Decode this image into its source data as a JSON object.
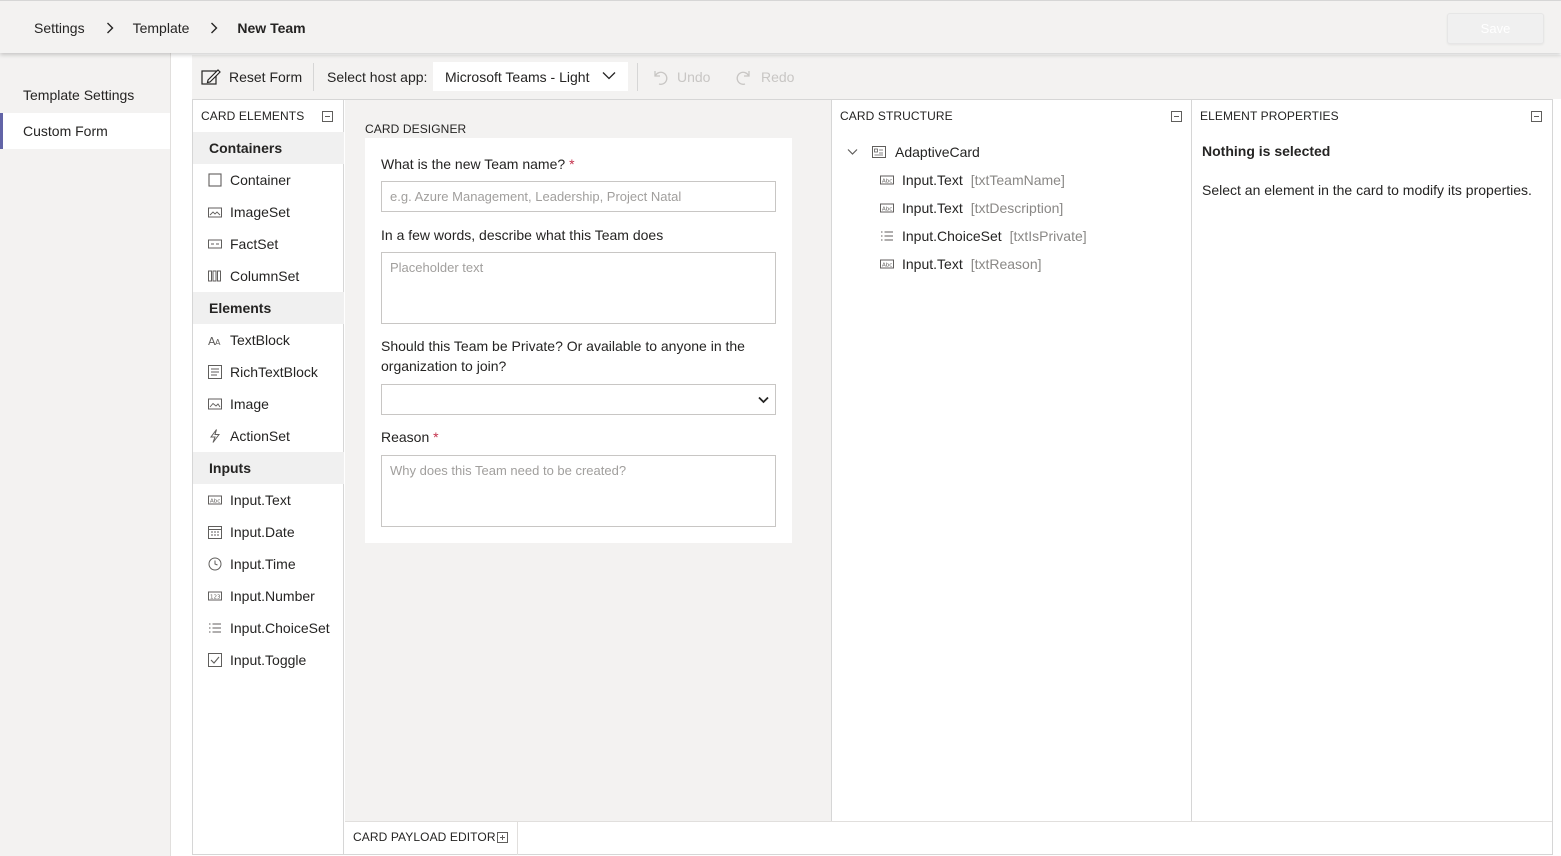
{
  "breadcrumb": {
    "items": [
      "Settings",
      "Template",
      "New Team"
    ]
  },
  "header": {
    "save_label": "Save"
  },
  "nav": {
    "items": [
      "Template Settings",
      "Custom Form"
    ],
    "active": "Custom Form"
  },
  "toolbar": {
    "reset_label": "Reset Form",
    "host_label": "Select host app:",
    "host_value": "Microsoft Teams - Light",
    "undo_label": "Undo",
    "redo_label": "Redo"
  },
  "palette": {
    "title": "CARD ELEMENTS",
    "categories": [
      {
        "name": "Containers",
        "items": [
          {
            "label": "Container",
            "icon": "container-icon"
          },
          {
            "label": "ImageSet",
            "icon": "imageset-icon"
          },
          {
            "label": "FactSet",
            "icon": "factset-icon"
          },
          {
            "label": "ColumnSet",
            "icon": "columnset-icon"
          }
        ]
      },
      {
        "name": "Elements",
        "items": [
          {
            "label": "TextBlock",
            "icon": "textblock-icon"
          },
          {
            "label": "RichTextBlock",
            "icon": "richtextblock-icon"
          },
          {
            "label": "Image",
            "icon": "image-icon"
          },
          {
            "label": "ActionSet",
            "icon": "actionset-icon"
          }
        ]
      },
      {
        "name": "Inputs",
        "items": [
          {
            "label": "Input.Text",
            "icon": "input-text-icon"
          },
          {
            "label": "Input.Date",
            "icon": "calendar-icon"
          },
          {
            "label": "Input.Time",
            "icon": "clock-icon"
          },
          {
            "label": "Input.Number",
            "icon": "number-icon"
          },
          {
            "label": "Input.ChoiceSet",
            "icon": "list-icon"
          },
          {
            "label": "Input.Toggle",
            "icon": "checkbox-icon"
          }
        ]
      }
    ]
  },
  "designer": {
    "title": "CARD DESIGNER",
    "fields": [
      {
        "label": "What is the new Team name?",
        "required": "*",
        "placeholder": "e.g. Azure Management, Leadership, Project Natal"
      },
      {
        "label": "In a few words, describe what this Team does",
        "required": "",
        "placeholder": "Placeholder text"
      },
      {
        "label": "Should this Team be Private? Or available to anyone in the organization to join?",
        "required": "",
        "placeholder": ""
      },
      {
        "label": "Reason",
        "required": "*",
        "placeholder": "Why does this Team need to be created?"
      }
    ]
  },
  "structure": {
    "title": "CARD STRUCTURE",
    "root": "AdaptiveCard",
    "children": [
      {
        "type": "Input.Text",
        "id": "[txtTeamName]",
        "icon": "input-text-icon"
      },
      {
        "type": "Input.Text",
        "id": "[txtDescription]",
        "icon": "input-text-icon"
      },
      {
        "type": "Input.ChoiceSet",
        "id": "[txtIsPrivate]",
        "icon": "list-icon"
      },
      {
        "type": "Input.Text",
        "id": "[txtReason]",
        "icon": "input-text-icon"
      }
    ]
  },
  "properties": {
    "title": "ELEMENT PROPERTIES",
    "heading": "Nothing is selected",
    "message": "Select an element in the card to modify its properties."
  },
  "payload": {
    "title": "CARD PAYLOAD EDITOR"
  },
  "colors": {
    "accent": "#6264a7",
    "required": "#c4314b",
    "panel_bg": "#f3f2f1"
  }
}
